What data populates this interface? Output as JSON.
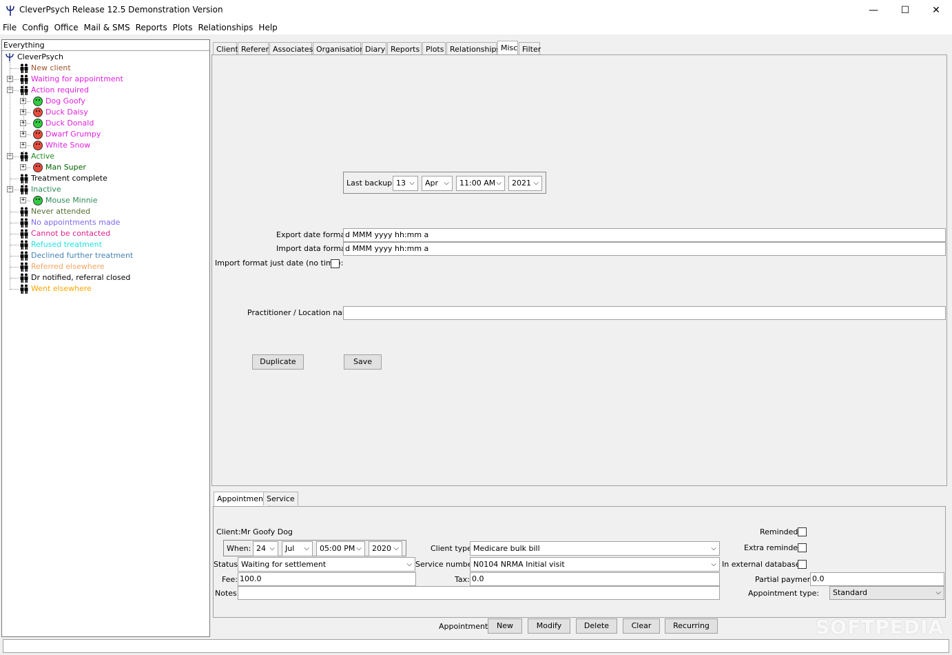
{
  "window": {
    "title": "CleverPsych Release 12.5 Demonstration Version",
    "minimize": "—",
    "maximize": "☐",
    "close": "✕"
  },
  "menu": [
    "File",
    "Config",
    "Office",
    "Mail & SMS",
    "Reports",
    "Plots",
    "Relationships",
    "Help"
  ],
  "tree": {
    "header": "Everything",
    "root": "CleverPsych",
    "items": [
      {
        "label": "New client",
        "color": "#a0522d"
      },
      {
        "label": "Waiting for appointment",
        "color": "#e020e0"
      },
      {
        "label": "Action required",
        "color": "#e020e0"
      },
      {
        "label": "Dog Goofy",
        "color": "#e020e0",
        "face": "green"
      },
      {
        "label": "Duck Daisy",
        "color": "#e020e0",
        "face": "red"
      },
      {
        "label": "Duck Donald",
        "color": "#e020e0",
        "face": "green"
      },
      {
        "label": "Dwarf Grumpy",
        "color": "#e020e0",
        "face": "red"
      },
      {
        "label": "White Snow",
        "color": "#e020e0",
        "face": "red"
      },
      {
        "label": "Active",
        "color": "#228b22"
      },
      {
        "label": "Man Super",
        "color": "#006400",
        "face": "red"
      },
      {
        "label": "Treatment complete",
        "color": "#000000"
      },
      {
        "label": "Inactive",
        "color": "#2e8b57"
      },
      {
        "label": "Mouse Minnie",
        "color": "#2e8b57",
        "face": "green"
      },
      {
        "label": "Never attended",
        "color": "#556b2f"
      },
      {
        "label": "No appointments made",
        "color": "#7b68ee"
      },
      {
        "label": "Cannot be contacted",
        "color": "#e0208c"
      },
      {
        "label": "Refused treatment",
        "color": "#20e0e0"
      },
      {
        "label": "Declined further treatment",
        "color": "#4682b4"
      },
      {
        "label": "Referred elsewhere",
        "color": "#f4a460"
      },
      {
        "label": "Dr notified, referral closed",
        "color": "#000000"
      },
      {
        "label": "Went elsewhere",
        "color": "#ffa500"
      }
    ]
  },
  "tabs": [
    "Client",
    "Referer",
    "Associates",
    "Organisation",
    "Diary",
    "Reports",
    "Plots",
    "Relationships",
    "Misc",
    "Filter"
  ],
  "active_tab": "Misc",
  "misc": {
    "last_backup_label": "Last backup:",
    "backup_day": "13",
    "backup_month": "Apr",
    "backup_time": "11:00 AM",
    "backup_year": "2021",
    "export_label": "Export date format:",
    "export_value": "d MMM yyyy hh:mm a",
    "import_label": "Import data format:",
    "import_value": "d MMM yyyy hh:mm a",
    "import_just_date_label": "Import format just date (no time):",
    "practitioner_label": "Practitioner / Location name:",
    "practitioner_value": "",
    "duplicate_button": "Duplicate",
    "save_button": "Save"
  },
  "bottom_tabs": [
    "Appointment",
    "Service"
  ],
  "appointment": {
    "client_label": "Client:Mr Goofy Dog",
    "when_label": "When:",
    "day": "24",
    "month": "Jul",
    "time": "05:00 PM",
    "year": "2020",
    "client_type_label": "Client type:",
    "client_type": "Medicare bulk bill",
    "reminded_label": "Reminded:",
    "extra_reminded_label": "Extra reminded",
    "status_label": "Status:",
    "status": "Waiting for settlement",
    "service_number_label": "Service number:",
    "service_number": "N0104 NRMA Initial visit",
    "external_db_label": "In external database:",
    "fee_label": "Fee:",
    "fee": "100.0",
    "tax_label": "Tax:",
    "tax": "0.0",
    "partial_payment_label": "Partial payment:",
    "partial_payment": "0.0",
    "notes_label": "Notes:",
    "notes": "",
    "appointment_type_label": "Appointment type:",
    "appointment_type": "Standard",
    "actions_label": "Appointment:",
    "new_button": "New",
    "modify_button": "Modify",
    "delete_button": "Delete",
    "clear_button": "Clear",
    "recurring_button": "Recurring"
  },
  "watermark": "SOFTPEDIA",
  "icons": {
    "dropdown": "chevron-down-icon",
    "arrow": "⌵"
  }
}
